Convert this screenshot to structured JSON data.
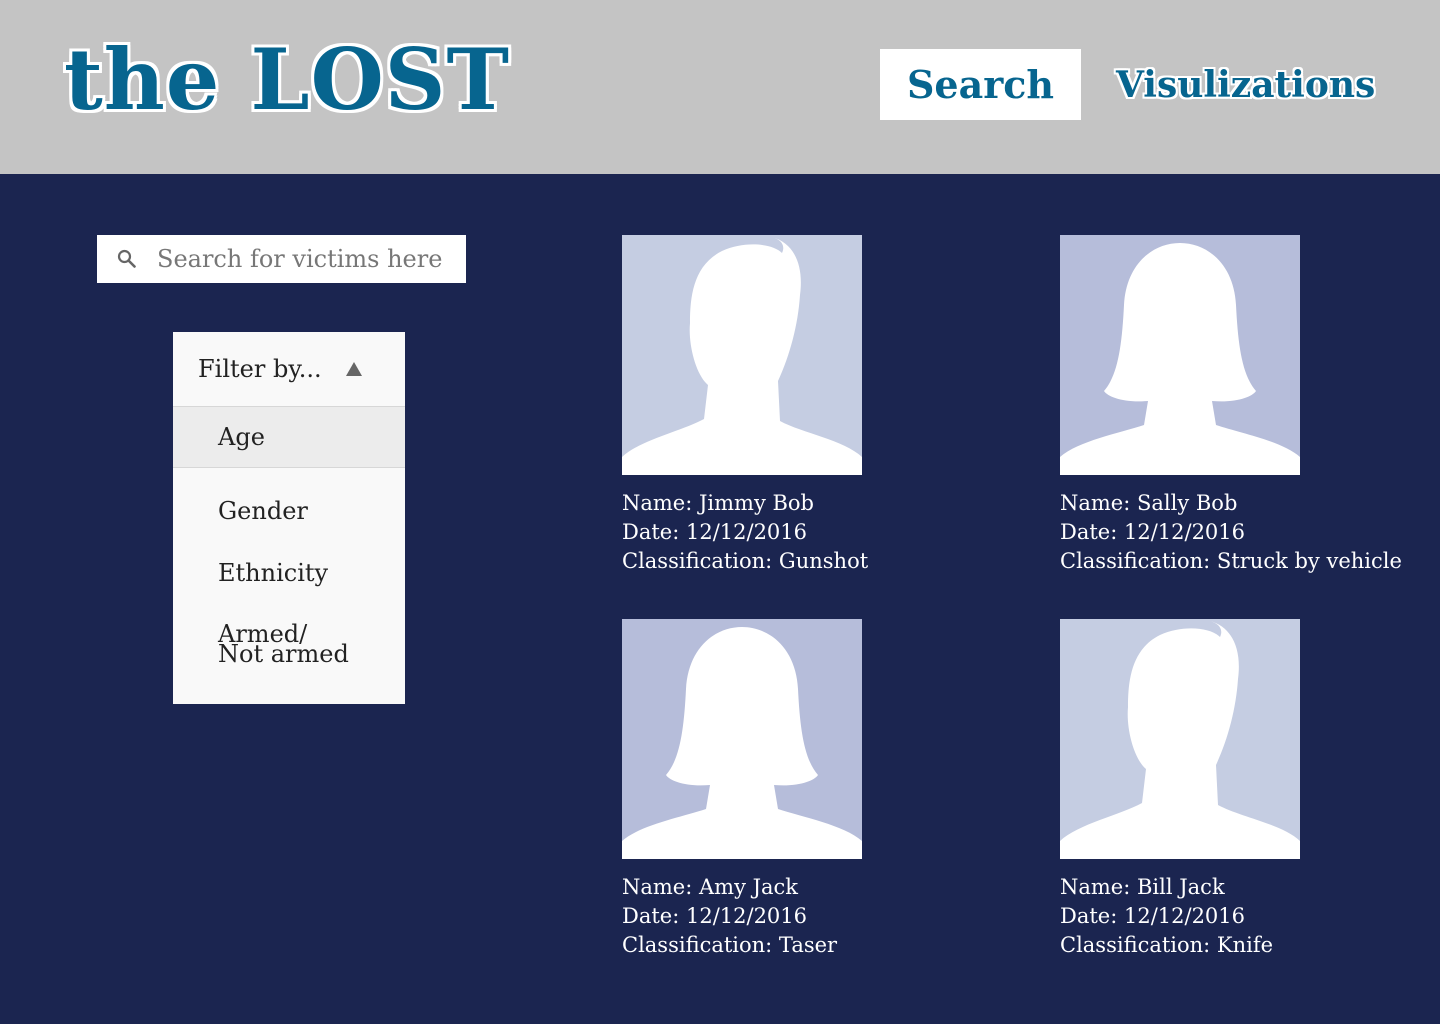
{
  "header": {
    "logo": "the LOST",
    "nav": {
      "search_label": "Search",
      "viz_label": "Visulizations"
    }
  },
  "search": {
    "placeholder": "Search for victims here",
    "value": ""
  },
  "filter": {
    "label": "Filter by...",
    "items": [
      "Age",
      "Gender",
      "Ethnicity"
    ],
    "armed_line1": "Armed/",
    "armed_line2": "Not armed"
  },
  "victims": [
    {
      "name": "Name: Jimmy Bob",
      "date": "Date: 12/12/2016",
      "classification": "Classification: Gunshot"
    },
    {
      "name": "Name: Sally Bob",
      "date": "Date: 12/12/2016",
      "classification": "Classification: Struck by vehicle"
    },
    {
      "name": "Name: Amy Jack",
      "date": "Date: 12/12/2016",
      "classification": "Classification: Taser"
    },
    {
      "name": "Name: Bill Jack",
      "date": "Date: 12/12/2016",
      "classification": "Classification: Knife"
    }
  ],
  "colors": {
    "background": "#1b2550",
    "header": "#c4c4c4",
    "brand": "#07658f",
    "avatar_male_bg": "#c5cde2",
    "avatar_female_bg": "#b6bdda"
  }
}
